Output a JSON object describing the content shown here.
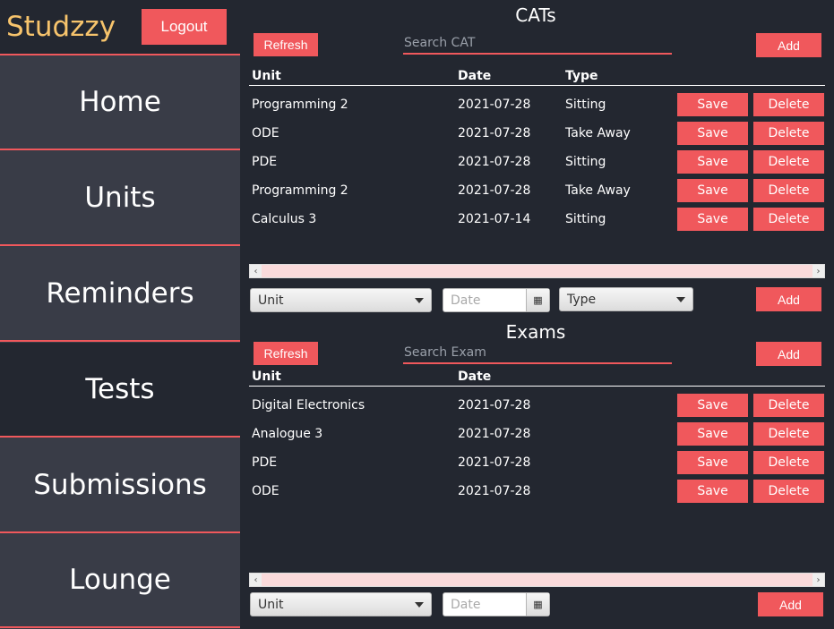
{
  "sidebar": {
    "brand": "Studzzy",
    "logout_label": "Logout",
    "items": [
      {
        "label": "Home"
      },
      {
        "label": "Units"
      },
      {
        "label": "Reminders"
      },
      {
        "label": "Tests"
      },
      {
        "label": "Submissions"
      },
      {
        "label": "Lounge"
      }
    ],
    "active": "Tests"
  },
  "cats": {
    "title": "CATs",
    "refresh_label": "Refresh",
    "search_placeholder": "Search CAT",
    "add_label": "Add",
    "columns": [
      "Unit",
      "Date",
      "Type"
    ],
    "rows": [
      {
        "unit": "Programming 2",
        "date": "2021-07-28",
        "type": "Sitting"
      },
      {
        "unit": "ODE",
        "date": "2021-07-28",
        "type": "Take Away"
      },
      {
        "unit": "PDE",
        "date": "2021-07-28",
        "type": "Sitting"
      },
      {
        "unit": "Programming 2",
        "date": "2021-07-28",
        "type": "Take Away"
      },
      {
        "unit": "Calculus 3",
        "date": "2021-07-14",
        "type": "Sitting"
      }
    ],
    "save_label": "Save",
    "delete_label": "Delete",
    "form": {
      "unit_select": "Unit",
      "date_placeholder": "Date",
      "type_select": "Type",
      "add_label": "Add"
    }
  },
  "exams": {
    "title": "Exams",
    "refresh_label": "Refresh",
    "search_placeholder": "Search Exam",
    "add_label": "Add",
    "columns": [
      "Unit",
      "Date"
    ],
    "rows": [
      {
        "unit": "Digital Electronics",
        "date": "2021-07-28"
      },
      {
        "unit": "Analogue 3",
        "date": "2021-07-28"
      },
      {
        "unit": "PDE",
        "date": "2021-07-28"
      },
      {
        "unit": "ODE",
        "date": "2021-07-28"
      }
    ],
    "save_label": "Save",
    "delete_label": "Delete",
    "form": {
      "unit_select": "Unit",
      "date_placeholder": "Date",
      "add_label": "Add"
    }
  },
  "colors": {
    "accent": "#f0585c",
    "brand": "#f7c46c",
    "background": "#232730",
    "sidebar": "#393c47"
  }
}
